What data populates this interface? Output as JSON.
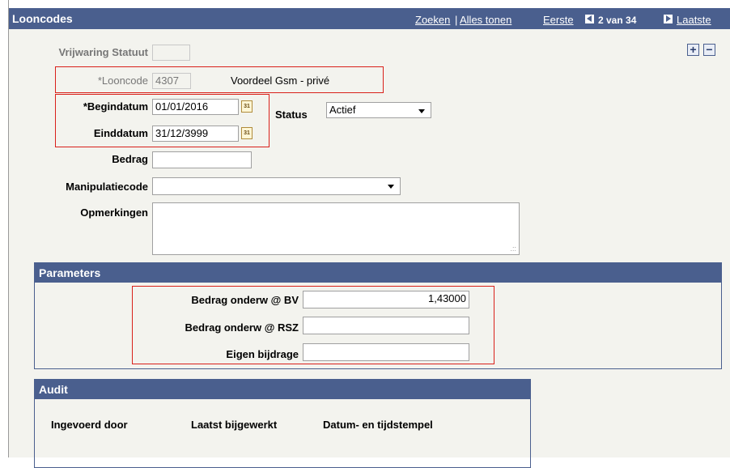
{
  "header": {
    "title": "Looncodes",
    "search_link": "Zoeken",
    "separator": "|",
    "show_all_link": "Alles tonen",
    "first_link": "Eerste",
    "counter": "2 van 34",
    "last_link": "Laatste"
  },
  "actions": {
    "add": "+",
    "remove": "−"
  },
  "fields": {
    "vrijwaring_statuut": {
      "label": "Vrijwaring Statuut",
      "value": ""
    },
    "looncode": {
      "label": "*Looncode",
      "value": "4307",
      "description": "Voordeel Gsm - privé"
    },
    "begindatum": {
      "label": "*Begindatum",
      "value": "01/01/2016"
    },
    "einddatum": {
      "label": "Einddatum",
      "value": "31/12/3999"
    },
    "status": {
      "label": "Status",
      "value": "Actief"
    },
    "bedrag": {
      "label": "Bedrag",
      "value": ""
    },
    "manipulatiecode": {
      "label": "Manipulatiecode",
      "value": ""
    },
    "opmerkingen": {
      "label": "Opmerkingen",
      "value": ""
    }
  },
  "calendar_icon": {
    "glyph": "31",
    "icon": "calendar-icon"
  },
  "parameters": {
    "title": "Parameters",
    "rows": [
      {
        "label": "Bedrag onderw @ BV",
        "value": "1,43000"
      },
      {
        "label": "Bedrag onderw @ RSZ",
        "value": ""
      },
      {
        "label": "Eigen bijdrage",
        "value": ""
      }
    ]
  },
  "audit": {
    "title": "Audit",
    "columns": [
      "Ingevoerd door",
      "Laatst bijgewerkt",
      "Datum- en tijdstempel"
    ]
  },
  "colors": {
    "header_bg": "#4a5f8e",
    "panel_bg": "#f3f3ee",
    "highlight": "#d9201a"
  }
}
